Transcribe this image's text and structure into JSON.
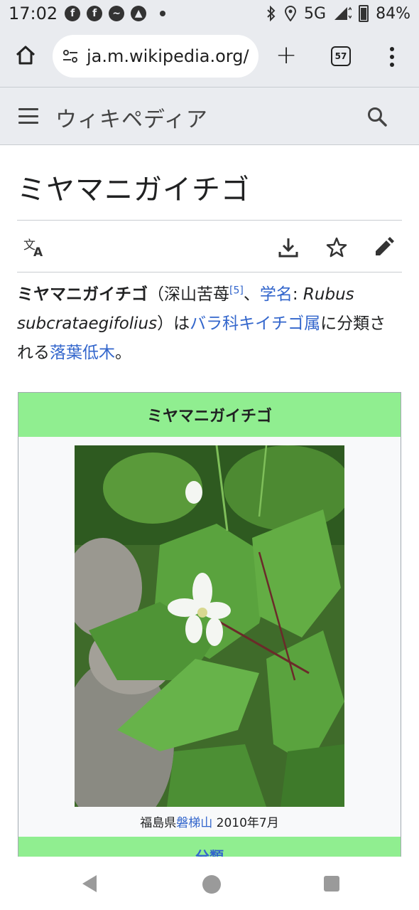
{
  "status_bar": {
    "time": "17:02",
    "notif_icons": [
      "facebook-icon",
      "facebook-icon",
      "messenger-icon",
      "strava-icon"
    ],
    "network": "5G",
    "battery": "84%",
    "battery_level": 0.84
  },
  "browser": {
    "url": "ja.m.wikipedia.org/",
    "tab_count": "57"
  },
  "wiki": {
    "wordmark": "ウィキペディア"
  },
  "article": {
    "title": "ミヤマニガイチゴ",
    "lead": {
      "bold_name": "ミヤマニガイチゴ",
      "paren_open": "（深山苦苺",
      "ref": "[5]",
      "comma": "、",
      "sci_link": "学名",
      "colon": ": ",
      "sci_name": "Rubus subcrataegifolius",
      "paren_close": "）は",
      "link_family": "バラ科キイチゴ属",
      "mid": "に分類される",
      "link_type": "落葉低木",
      "end": "。"
    },
    "infobox": {
      "title": "ミヤマニガイチゴ",
      "caption_prefix": "福島県",
      "caption_link": "磐梯山",
      "caption_suffix": " 2010年7月",
      "section": "分類"
    }
  },
  "colors": {
    "infobox_header": "#90ee90",
    "link": "#3366cc",
    "chrome_bg": "#e9ebef"
  }
}
